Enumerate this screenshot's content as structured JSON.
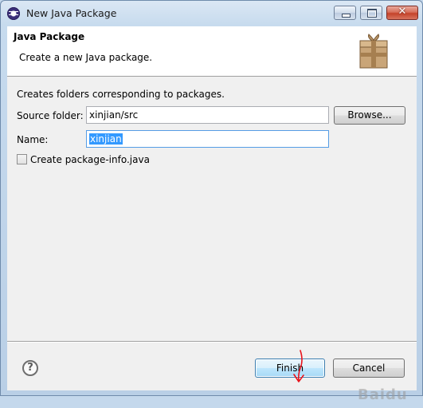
{
  "window": {
    "title": "New Java Package"
  },
  "header": {
    "title": "Java Package",
    "description": "Create a new Java package."
  },
  "form": {
    "intro": "Creates folders corresponding to packages.",
    "source_folder_label": "Source folder:",
    "source_folder_value": "xinjian/src",
    "browse_label": "Browse...",
    "name_label": "Name:",
    "name_value": "xinjian",
    "checkbox_label": "Create package-info.java",
    "checkbox_checked": false
  },
  "footer": {
    "help_icon": "help-icon",
    "finish_label": "Finish",
    "cancel_label": "Cancel"
  },
  "watermark": {
    "text": "Baidu"
  },
  "colors": {
    "selection": "#3399ff",
    "annotation_arrow": "#e8141c",
    "close_button": "#c4432a"
  }
}
